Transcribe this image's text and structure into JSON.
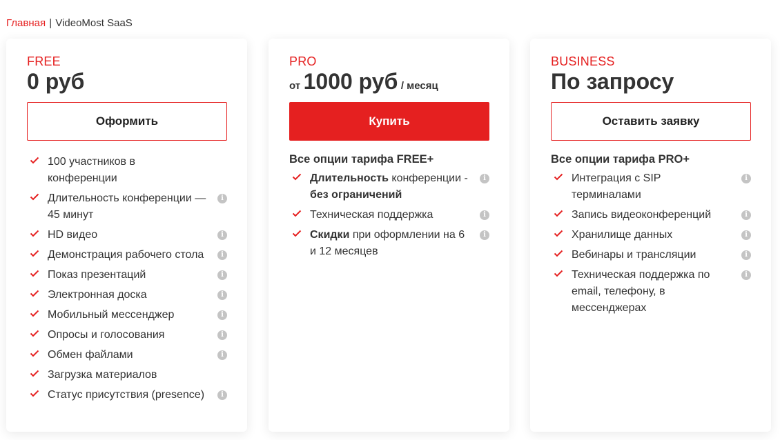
{
  "breadcrumb": {
    "home": "Главная",
    "separator": "|",
    "current": "VideoMost SaaS"
  },
  "colors": {
    "accent": "#e52020",
    "text": "#333333",
    "info_icon": "#c4c4c4"
  },
  "plans": {
    "free": {
      "tier": "FREE",
      "price": "0 руб",
      "button": "Оформить",
      "features": [
        {
          "text": "100 участников в конференции",
          "info": false
        },
        {
          "text": "Длительность конференции — 45 минут",
          "info": true
        },
        {
          "text": "HD видео",
          "info": true
        },
        {
          "text": "Демонстрация рабочего стола",
          "info": true
        },
        {
          "text": "Показ презентаций",
          "info": true
        },
        {
          "text": "Электронная доска",
          "info": true
        },
        {
          "text": "Мобильный мессенджер",
          "info": true
        },
        {
          "text": "Опросы и голосования",
          "info": true
        },
        {
          "text": "Обмен файлами",
          "info": true
        },
        {
          "text": "Загрузка материалов",
          "info": false
        },
        {
          "text": "Статус присутствия (presence)",
          "info": true
        }
      ]
    },
    "pro": {
      "tier": "PRO",
      "price_prefix": "от",
      "price": "1000 руб",
      "price_suffix": "/ месяц",
      "button": "Купить",
      "includes": "Все опции тарифа FREE+",
      "features": [
        {
          "bold": "Длительность",
          "text": " конференции - ",
          "bold2": "без ограничений",
          "info": true
        },
        {
          "text": "Техническая поддержка",
          "info": true
        },
        {
          "bold": "Скидки",
          "text": " при оформлении на 6 и 12 месяцев",
          "info": true
        }
      ]
    },
    "business": {
      "tier": "BUSINESS",
      "price": "По запросу",
      "button": "Оставить заявку",
      "includes": "Все опции тарифа PRO+",
      "features": [
        {
          "text": "Интеграция с SIP терминалами",
          "info": true
        },
        {
          "text": "Запись видеоконференций",
          "info": true
        },
        {
          "text": "Хранилище данных",
          "info": true
        },
        {
          "text": "Вебинары и трансляции",
          "info": true
        },
        {
          "text": "Техническая поддержка по email, телефону, в мессенджерах",
          "info": true
        }
      ]
    }
  }
}
